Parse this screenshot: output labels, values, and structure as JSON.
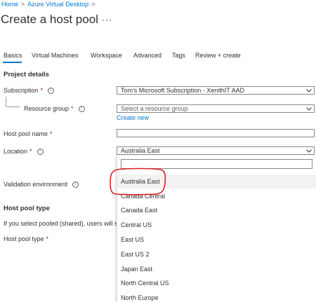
{
  "breadcrumb": {
    "home": "Home",
    "separator": ">",
    "avd": "Azure Virtual Desktop"
  },
  "page": {
    "title": "Create a host pool",
    "more": "···"
  },
  "tabs": [
    {
      "label": "Basics",
      "active": true
    },
    {
      "label": "Virtual Machines"
    },
    {
      "label": "Workspace"
    },
    {
      "label": "Advanced"
    },
    {
      "label": "Tags"
    },
    {
      "label": "Review + create"
    }
  ],
  "project_details": {
    "heading": "Project details",
    "subscription": {
      "label": "Subscription",
      "required_mark": "*",
      "value": "Tom's Microsoft Subscription - XenithIT AAD"
    },
    "resource_group": {
      "label": "Resource group",
      "required_mark": "*",
      "placeholder": "Select a resource group",
      "create_new": "Create new"
    },
    "host_pool_name": {
      "label": "Host pool name",
      "required_mark": "*",
      "value": ""
    },
    "location": {
      "label": "Location",
      "required_mark": "*",
      "value": "Australia East"
    },
    "validation": {
      "label": "Validation environment"
    }
  },
  "host_pool_type": {
    "heading": "Host pool type",
    "description": "If you select pooled (shared), users will still b",
    "label": "Host pool type",
    "required_mark": "*"
  },
  "location_dropdown": {
    "search_value": "",
    "options": [
      "Australia East",
      "Canada Central",
      "Canada East",
      "Central US",
      "East US",
      "East US 2",
      "Japan East",
      "North Central US",
      "North Europe"
    ],
    "selected": "Australia East"
  },
  "annotation_color": "#e02020",
  "icons": {
    "info": "info-icon",
    "chevron": "chevron-down-icon",
    "breadcrumb_sep": "chevron-right-icon"
  }
}
